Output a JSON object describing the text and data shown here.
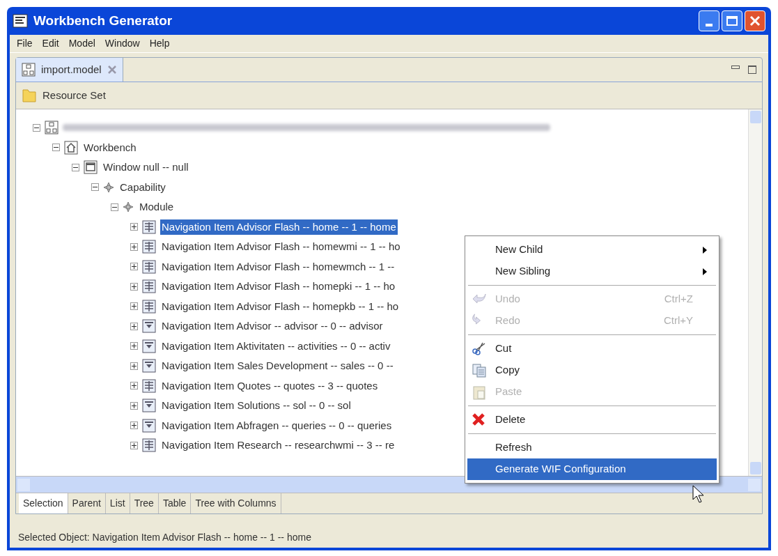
{
  "window": {
    "title": "Workbench Generator"
  },
  "menu_bar": [
    "File",
    "Edit",
    "Model",
    "Window",
    "Help"
  ],
  "editor_tab": {
    "label": "import.model",
    "selected": true
  },
  "resource_set": {
    "label": "Resource Set"
  },
  "tree": {
    "root": {
      "kind": "root",
      "expanded": true,
      "label_blurred": true,
      "children": [
        {
          "kind": "workbench",
          "label": "Workbench",
          "expanded": true,
          "children": [
            {
              "kind": "window",
              "label": "Window null -- null",
              "expanded": true,
              "children": [
                {
                  "kind": "node",
                  "label": "Capability",
                  "expanded": true,
                  "children": [
                    {
                      "kind": "node",
                      "label": "Module",
                      "expanded": true,
                      "children": [
                        {
                          "kind": "list",
                          "label": "Navigation Item Advisor Flash -- home -- 1 -- home",
                          "expanded": false,
                          "selected": true
                        },
                        {
                          "kind": "list",
                          "label": "Navigation Item Advisor Flash -- homewmi -- 1 -- ho",
                          "expanded": false,
                          "selected": false
                        },
                        {
                          "kind": "list",
                          "label": "Navigation Item Advisor Flash -- homewmch -- 1 --",
                          "expanded": false,
                          "selected": false
                        },
                        {
                          "kind": "list",
                          "label": "Navigation Item Advisor Flash -- homepki -- 1 -- ho",
                          "expanded": false,
                          "selected": false
                        },
                        {
                          "kind": "list",
                          "label": "Navigation Item Advisor Flash -- homepkb -- 1 -- ho",
                          "expanded": false,
                          "selected": false
                        },
                        {
                          "kind": "dropdown",
                          "label": "Navigation Item Advisor -- advisor -- 0 -- advisor",
                          "expanded": false,
                          "selected": false
                        },
                        {
                          "kind": "dropdown",
                          "label": "Navigation Item Aktivitaten -- activities -- 0 -- activ",
                          "expanded": false,
                          "selected": false
                        },
                        {
                          "kind": "dropdown",
                          "label": "Navigation Item Sales Development -- sales -- 0 --",
                          "expanded": false,
                          "selected": false
                        },
                        {
                          "kind": "list",
                          "label": "Navigation Item Quotes -- quotes -- 3 -- quotes",
                          "expanded": false,
                          "selected": false
                        },
                        {
                          "kind": "dropdown",
                          "label": "Navigation Item Solutions -- sol -- 0 -- sol",
                          "expanded": false,
                          "selected": false
                        },
                        {
                          "kind": "dropdown",
                          "label": "Navigation Item Abfragen -- queries -- 0 -- queries",
                          "expanded": false,
                          "selected": false
                        },
                        {
                          "kind": "list",
                          "label": "Navigation Item Research -- researchwmi -- 3 -- re",
                          "expanded": false,
                          "selected": false
                        }
                      ]
                    }
                  ]
                }
              ]
            }
          ]
        }
      ]
    }
  },
  "bottom_tabs": [
    {
      "label": "Selection",
      "selected": true
    },
    {
      "label": "Parent",
      "selected": false
    },
    {
      "label": "List",
      "selected": false
    },
    {
      "label": "Tree",
      "selected": false
    },
    {
      "label": "Table",
      "selected": false
    },
    {
      "label": "Tree with Columns",
      "selected": false
    }
  ],
  "context_menu": [
    {
      "kind": "submenu",
      "label": "New Child",
      "disabled": false,
      "selected": false
    },
    {
      "kind": "submenu",
      "label": "New Sibling",
      "disabled": false,
      "selected": false
    },
    {
      "kind": "separator"
    },
    {
      "kind": "undo",
      "label": "Undo",
      "shortcut": "Ctrl+Z",
      "disabled": true,
      "selected": false
    },
    {
      "kind": "redo",
      "label": "Redo",
      "shortcut": "Ctrl+Y",
      "disabled": true,
      "selected": false
    },
    {
      "kind": "separator"
    },
    {
      "kind": "cut",
      "label": "Cut",
      "disabled": false,
      "selected": false
    },
    {
      "kind": "copy",
      "label": "Copy",
      "disabled": false,
      "selected": false
    },
    {
      "kind": "paste",
      "label": "Paste",
      "disabled": true,
      "selected": false
    },
    {
      "kind": "separator"
    },
    {
      "kind": "delete",
      "label": "Delete",
      "disabled": false,
      "selected": false
    },
    {
      "kind": "separator"
    },
    {
      "kind": "plain",
      "label": "Refresh",
      "disabled": false,
      "selected": false
    },
    {
      "kind": "plain",
      "label": "Generate WIF Configuration",
      "disabled": false,
      "selected": true
    }
  ],
  "status_bar": "Selected Object: Navigation Item Advisor Flash -- home -- 1 -- home"
}
